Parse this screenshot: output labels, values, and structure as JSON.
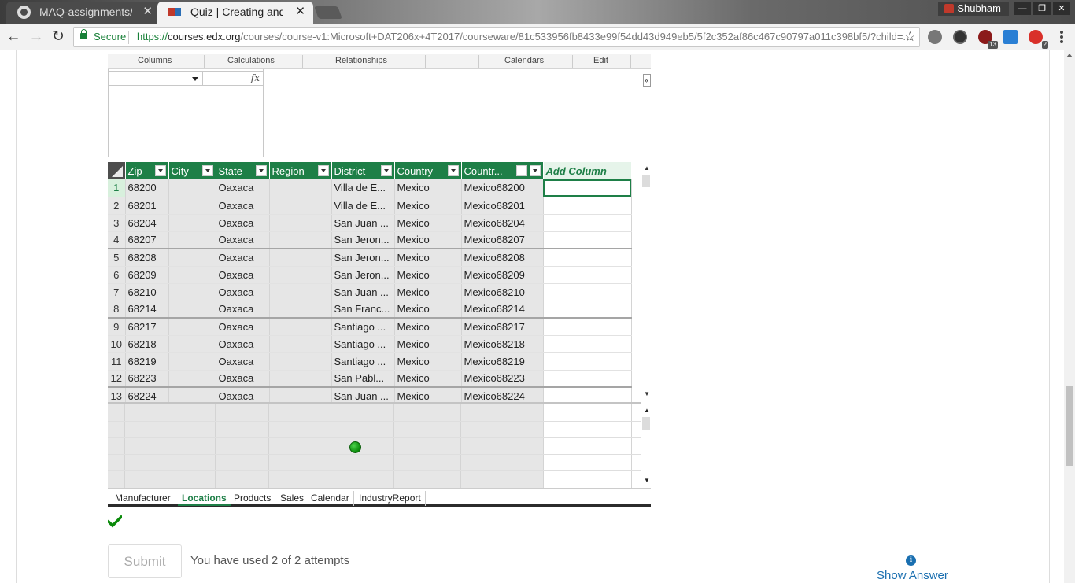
{
  "browser": {
    "tabs": [
      {
        "title": "MAQ-assignments/co",
        "icon": "github-icon"
      },
      {
        "title": "Quiz | Creating and F",
        "icon": "edx-icon"
      }
    ],
    "profile_name": "Shubham",
    "omnibox": {
      "secure_label": "Secure",
      "scheme": "https://",
      "host": "courses.edx.org",
      "path": "/courses/course-v1:Microsoft+DAT206x+4T2017/courseware/81c533956fb8433e99f54dd43d949eb5/5f2c352af86c467c90797a011c398bf5/?child=..."
    },
    "extensions": [
      {
        "name": "ext-1-icon",
        "badge": ""
      },
      {
        "name": "ext-speed-icon",
        "badge": ""
      },
      {
        "name": "ext-ublock-icon",
        "badge": "13"
      },
      {
        "name": "ext-blue-icon",
        "badge": ""
      },
      {
        "name": "ext-red-icon",
        "badge": "2"
      }
    ]
  },
  "pbi": {
    "ribbon": [
      "Columns",
      "Calculations",
      "Relationships",
      "Calendars",
      "Edit"
    ],
    "fx_symbol": "fx",
    "columns": [
      "Zip",
      "City",
      "State",
      "Region",
      "District",
      "Country",
      "Countr...",
      "Add Column"
    ],
    "rows": [
      {
        "n": "1",
        "zip": "68200",
        "city": "",
        "state": "Oaxaca",
        "region": "",
        "district": "Villa de E...",
        "country": "Mexico",
        "cc": "Mexico68200"
      },
      {
        "n": "2",
        "zip": "68201",
        "city": "",
        "state": "Oaxaca",
        "region": "",
        "district": "Villa de E...",
        "country": "Mexico",
        "cc": "Mexico68201"
      },
      {
        "n": "3",
        "zip": "68204",
        "city": "",
        "state": "Oaxaca",
        "region": "",
        "district": "San Juan ...",
        "country": "Mexico",
        "cc": "Mexico68204"
      },
      {
        "n": "4",
        "zip": "68207",
        "city": "",
        "state": "Oaxaca",
        "region": "",
        "district": "San Jeron...",
        "country": "Mexico",
        "cc": "Mexico68207"
      },
      {
        "n": "5",
        "zip": "68208",
        "city": "",
        "state": "Oaxaca",
        "region": "",
        "district": "San Jeron...",
        "country": "Mexico",
        "cc": "Mexico68208"
      },
      {
        "n": "6",
        "zip": "68209",
        "city": "",
        "state": "Oaxaca",
        "region": "",
        "district": "San Jeron...",
        "country": "Mexico",
        "cc": "Mexico68209"
      },
      {
        "n": "7",
        "zip": "68210",
        "city": "",
        "state": "Oaxaca",
        "region": "",
        "district": "San Juan ...",
        "country": "Mexico",
        "cc": "Mexico68210"
      },
      {
        "n": "8",
        "zip": "68214",
        "city": "",
        "state": "Oaxaca",
        "region": "",
        "district": "San Franc...",
        "country": "Mexico",
        "cc": "Mexico68214"
      },
      {
        "n": "9",
        "zip": "68217",
        "city": "",
        "state": "Oaxaca",
        "region": "",
        "district": "Santiago ...",
        "country": "Mexico",
        "cc": "Mexico68217"
      },
      {
        "n": "10",
        "zip": "68218",
        "city": "",
        "state": "Oaxaca",
        "region": "",
        "district": "Santiago ...",
        "country": "Mexico",
        "cc": "Mexico68218"
      },
      {
        "n": "11",
        "zip": "68219",
        "city": "",
        "state": "Oaxaca",
        "region": "",
        "district": "Santiago ...",
        "country": "Mexico",
        "cc": "Mexico68219"
      },
      {
        "n": "12",
        "zip": "68223",
        "city": "",
        "state": "Oaxaca",
        "region": "",
        "district": "San Pabl...",
        "country": "Mexico",
        "cc": "Mexico68223"
      },
      {
        "n": "13",
        "zip": "68224",
        "city": "",
        "state": "Oaxaca",
        "region": "",
        "district": "San Juan ...",
        "country": "Mexico",
        "cc": "Mexico68224"
      }
    ],
    "sheets": [
      "Manufacturer",
      "Locations",
      "Products",
      "Sales",
      "Calendar",
      "IndustryReport"
    ],
    "active_sheet": "Locations"
  },
  "quiz": {
    "submit_label": "Submit",
    "attempts_text": "You have used 2 of 2 attempts",
    "show_answer_label": "Show Answer",
    "info_glyph": "i"
  }
}
